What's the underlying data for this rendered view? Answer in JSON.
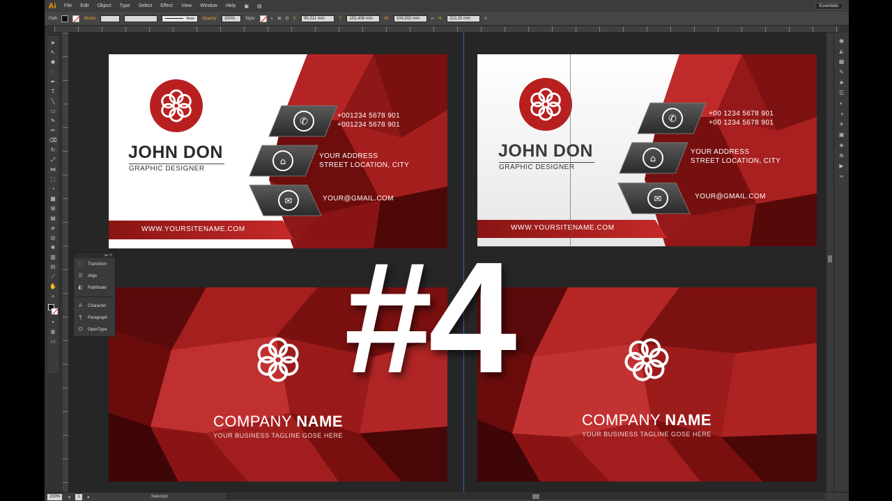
{
  "app": {
    "logo": "Ai",
    "menu": [
      "File",
      "Edit",
      "Object",
      "Type",
      "Select",
      "Effect",
      "View",
      "Window",
      "Help"
    ],
    "workspace": "Essentials"
  },
  "control_bar": {
    "selection_type": "Path",
    "stroke_label": "Stroke",
    "brush_label": "Basic",
    "opacity_label": "Opacity:",
    "opacity_value": "100%",
    "style_label": "Style:",
    "x_label": "X:",
    "x_value": "90,311 mm",
    "y_label": "Y:",
    "y_value": "153,408 mm",
    "w_label": "W:",
    "w_value": "106,502 mm",
    "h_label": "H:",
    "h_value": "222,25 mm"
  },
  "panel": {
    "items": [
      "Transform",
      "Align",
      "Pathfinder",
      "Character",
      "Paragraph",
      "OpenType"
    ]
  },
  "status_bar": {
    "zoom": "200%",
    "artboard": "1",
    "mode": "Selection"
  },
  "overlay": {
    "episode": "#4"
  },
  "card_front_1": {
    "name": "JOHN DON",
    "role": "GRAPHIC DESIGNER",
    "phone1": "+001234 5678 901",
    "phone2": "+001234 5678 901",
    "address1": "YOUR ADDRESS",
    "address2": "STREET LOCATION, CITY",
    "email": "YOUR@GMAIL.COM",
    "website": "WWW.YOURSITENAME.COM"
  },
  "card_front_2": {
    "name": "JOHN DON",
    "role": "GRAPHIC DESIGNER",
    "phone1": "+00 1234 5678 901",
    "phone2": "+00 1234 5678 901",
    "address1": "YOUR ADDRESS",
    "address2": "STREET LOCATION, CITY",
    "email": "YOUR@GMAIL.COM",
    "website": "WWW.YOURSITENAME.COM"
  },
  "card_back_1": {
    "company_light": "COMPANY",
    "company_bold": "NAME",
    "tagline": "YOUR BUSINESS TAGLINE GOSE HERE"
  },
  "card_back_2": {
    "company_light": "COMPANY",
    "company_bold": "NAME",
    "tagline": "YOUR BUSINESS TAGLINE GOSE HERE"
  },
  "colors": {
    "card_red": "#9a1a1a",
    "card_dark": "#3a0808",
    "accent_orange": "#ff9a00",
    "guide_blue": "#3a63c8"
  }
}
